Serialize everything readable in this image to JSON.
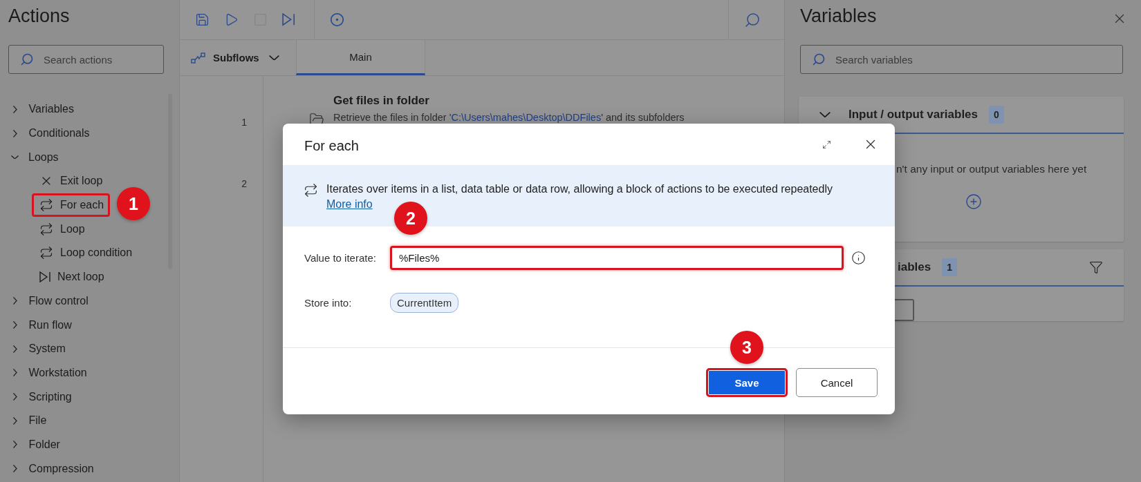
{
  "actions_panel": {
    "title": "Actions",
    "search": {
      "placeholder": "Search actions"
    },
    "tree": [
      {
        "label": "Variables",
        "expanded": false
      },
      {
        "label": "Conditionals",
        "expanded": false
      },
      {
        "label": "Loops",
        "expanded": true,
        "children": [
          {
            "kind": "exit",
            "label": "Exit loop",
            "highlighted": false
          },
          {
            "kind": "loop",
            "label": "For each",
            "highlighted": true
          },
          {
            "kind": "loop",
            "label": "Loop",
            "highlighted": false
          },
          {
            "kind": "loop",
            "label": "Loop condition",
            "highlighted": false
          },
          {
            "kind": "next",
            "label": "Next loop",
            "highlighted": false
          }
        ]
      },
      {
        "label": "Flow control",
        "expanded": false
      },
      {
        "label": "Run flow",
        "expanded": false
      },
      {
        "label": "System",
        "expanded": false
      },
      {
        "label": "Workstation",
        "expanded": false
      },
      {
        "label": "Scripting",
        "expanded": false
      },
      {
        "label": "File",
        "expanded": false
      },
      {
        "label": "Folder",
        "expanded": false
      },
      {
        "label": "Compression",
        "expanded": false
      }
    ]
  },
  "toolbar": {
    "buttons": [
      {
        "kind": "save",
        "disabled": false
      },
      {
        "kind": "run",
        "disabled": false
      },
      {
        "kind": "stop",
        "disabled": true
      },
      {
        "kind": "step",
        "disabled": false
      },
      {
        "kind": "record",
        "disabled": false
      }
    ]
  },
  "subflows": {
    "label": "Subflows"
  },
  "tabs": [
    {
      "label": "Main",
      "selected": true
    }
  ],
  "flow": {
    "steps": [
      {
        "number": "1",
        "title": "Get files in folder",
        "description_prefix": "Retrieve the files in folder '",
        "description_link": "C:\\Users\\mahes\\Desktop\\DDFiles",
        "description_suffix": "' and its subfolders"
      },
      {
        "number": "2"
      }
    ]
  },
  "variables_panel": {
    "title": "Variables",
    "search": {
      "placeholder": "Search variables"
    },
    "sections": [
      {
        "kind": "io",
        "title": "Input / output variables",
        "count": "0",
        "expanded": true,
        "empty_text": "n't any input or output variables here yet"
      },
      {
        "kind": "flow",
        "title": "iables",
        "count": "1"
      }
    ]
  },
  "dialog": {
    "title": "For each",
    "description": "Iterates over items in a list, data table or data row, allowing a block of actions to be executed repeatedly",
    "more_info": "More info",
    "fields": [
      {
        "kind": "text",
        "label": "Value to iterate:",
        "value": "%Files%",
        "highlighted": true
      },
      {
        "kind": "chip",
        "label": "Store into:",
        "value": "CurrentItem",
        "highlighted": false
      }
    ],
    "buttons": [
      {
        "kind": "primary",
        "label": "Save",
        "highlighted": true
      },
      {
        "kind": "secondary",
        "label": "Cancel",
        "highlighted": false
      }
    ]
  },
  "annotations": [
    {
      "label": "1"
    },
    {
      "label": "2"
    },
    {
      "label": "3"
    }
  ]
}
